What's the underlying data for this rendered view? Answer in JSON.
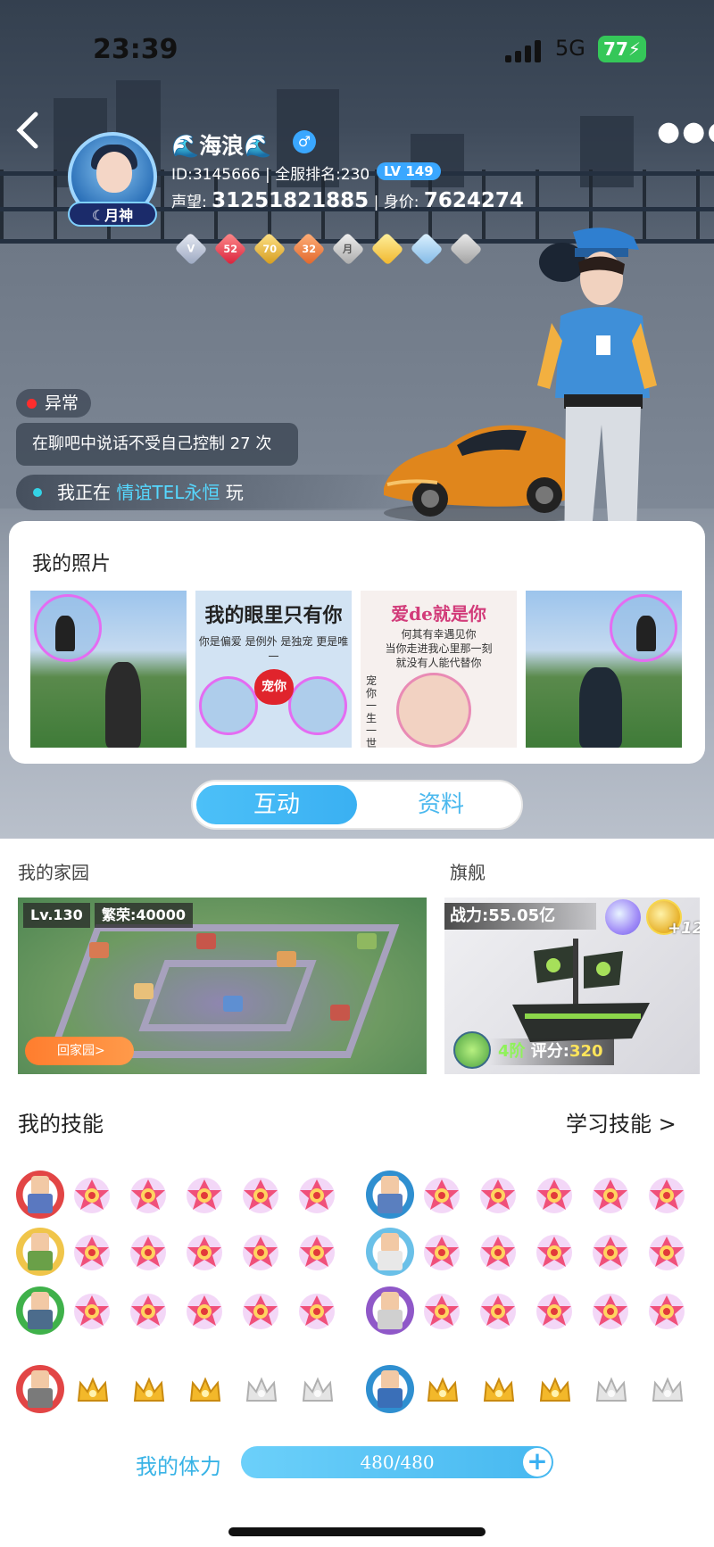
{
  "status_bar": {
    "time": "23:39",
    "network": "5G",
    "battery": "77"
  },
  "profile": {
    "nickname": "🌊海浪🌊",
    "gender_symbol": "♂",
    "id_line": "ID:3145666 | 全服排名:230",
    "level": "LV 149",
    "prestige_label": "声望: ",
    "prestige_value": "31251821885",
    "worth_label": " | 身价: ",
    "worth_value": "7624274",
    "avatar_tag": "月神",
    "badges": [
      "V",
      "52",
      "70",
      "32",
      "月",
      "",
      "",
      ""
    ]
  },
  "state": {
    "abnormal": "异常",
    "status_text": "在聊吧中说话不受自己控制 27 次",
    "playing_prefix": "我正在 ",
    "playing_game": "情谊TEL永恒",
    "playing_suffix": " 玩"
  },
  "photos": {
    "title": "我的照片",
    "photo2_title": "我的眼里只有你",
    "photo2_caption": "你是偏爱 是例外 是独宠 更是唯一",
    "photo2_badge": "宠你",
    "photo3_title": "爱de就是你",
    "photo3_lines": [
      "何其有幸遇见你",
      "当你走进我心里那一刻",
      "就没有人能代替你"
    ],
    "photo3_side": "宠你一生一世"
  },
  "tabs": {
    "active": "互动",
    "other": "资料"
  },
  "home": {
    "title": "我的家园",
    "level": "Lv.130",
    "prosperity": "繁荣:40000",
    "button": "回家园>"
  },
  "flagship": {
    "title": "旗舰",
    "power": "战力:55.05亿",
    "plus": "+12",
    "tier": "4阶",
    "score_label": " 评分:",
    "score_value": "320"
  },
  "skills": {
    "title": "我的技能",
    "learn": "学习技能 >"
  },
  "stamina": {
    "label": "我的体力",
    "value": "480/480",
    "plus": "+"
  }
}
